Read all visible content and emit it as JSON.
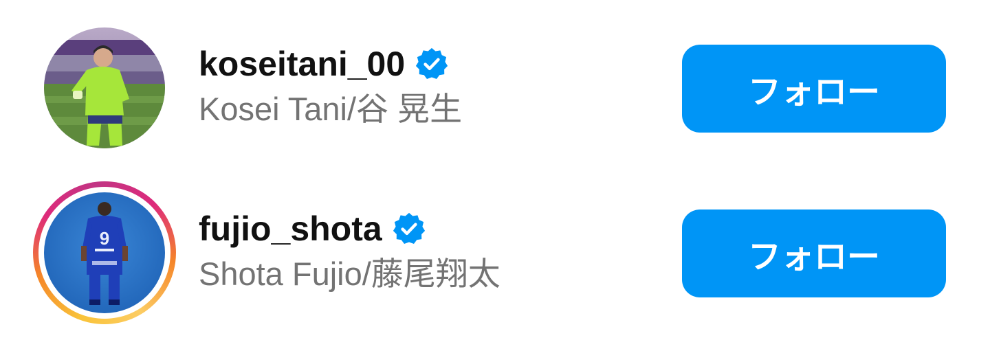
{
  "suggestions": [
    {
      "username": "koseitani_00",
      "full_name": "Kosei Tani/谷 晃生",
      "verified": true,
      "has_story_ring": false,
      "avatar_icon": "goalkeeper-photo",
      "follow_label": "フォロー"
    },
    {
      "username": "fujio_shota",
      "full_name": "Shota Fujio/藤尾翔太",
      "verified": true,
      "has_story_ring": true,
      "avatar_icon": "player-back-photo",
      "follow_label": "フォロー"
    }
  ],
  "colors": {
    "follow_button": "#0095f6",
    "verified_badge": "#0095f6",
    "username": "#111111",
    "full_name": "#737373"
  }
}
